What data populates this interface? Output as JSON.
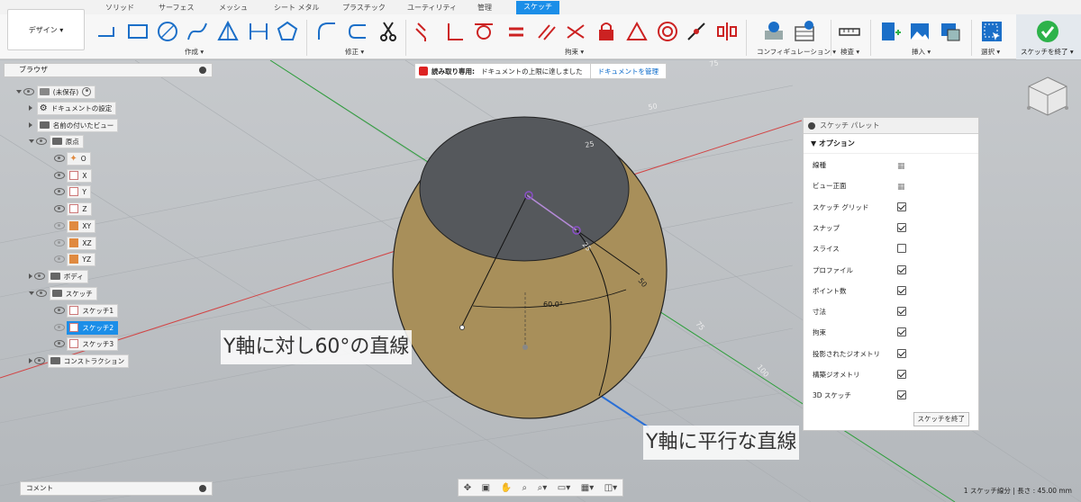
{
  "tabs": [
    "ソリッド",
    "サーフェス",
    "メッシュ",
    "シート メタル",
    "プラスチック",
    "ユーティリティ",
    "管理",
    "スケッチ"
  ],
  "design_button": "デザイン ▾",
  "ribbon_groups": {
    "create": "作成 ▾",
    "modify": "修正 ▾",
    "constraints": "拘束 ▾",
    "configuration": "コンフィギュレーション ▾",
    "inspect": "検査 ▾",
    "insert": "挿入 ▾",
    "select": "選択 ▾",
    "finish": "スケッチを終了 ▾"
  },
  "browser": {
    "title": "ブラウザ",
    "items": [
      {
        "label": "(未保存)"
      },
      {
        "label": "ドキュメントの設定"
      },
      {
        "label": "名前の付いたビュー"
      },
      {
        "label": "原点"
      },
      {
        "label": "O"
      },
      {
        "label": "X"
      },
      {
        "label": "Y"
      },
      {
        "label": "Z"
      },
      {
        "label": "XY"
      },
      {
        "label": "XZ"
      },
      {
        "label": "YZ"
      },
      {
        "label": "ボディ"
      },
      {
        "label": "スケッチ"
      },
      {
        "label": "スケッチ1"
      },
      {
        "label": "スケッチ2"
      },
      {
        "label": "スケッチ3"
      },
      {
        "label": "コンストラクション"
      }
    ]
  },
  "banner": {
    "prefix": "読み取り専用:",
    "message": "ドキュメントの上限に達しました",
    "action": "ドキュメントを管理"
  },
  "palette": {
    "title": "スケッチ パレット",
    "section": "▼ オプション",
    "rows": [
      {
        "label": "線種",
        "checked": null
      },
      {
        "label": "ビュー正面",
        "checked": null
      },
      {
        "label": "スケッチ グリッド",
        "checked": true
      },
      {
        "label": "スナップ",
        "checked": true
      },
      {
        "label": "スライス",
        "checked": false
      },
      {
        "label": "プロファイル",
        "checked": true
      },
      {
        "label": "ポイント数",
        "checked": true
      },
      {
        "label": "寸法",
        "checked": true
      },
      {
        "label": "拘束",
        "checked": true
      },
      {
        "label": "投影されたジオメトリ",
        "checked": true
      },
      {
        "label": "構築ジオメトリ",
        "checked": true
      },
      {
        "label": "3D スケッチ",
        "checked": true
      }
    ],
    "finish_button": "スケッチを終了"
  },
  "viewport": {
    "angle_label": "60.0°",
    "axis_ticks": [
      "75",
      "50",
      "25",
      "25",
      "50",
      "75",
      "100"
    ]
  },
  "callouts": {
    "line60": "Y軸に対し60°の直線",
    "parallel": "Y軸に平行な直線"
  },
  "comment": "コメント",
  "status": "1 スケッチ線分 | 長さ : 45.00 mm",
  "colors": {
    "accent": "#1b8ee8",
    "sphere": "#a88f5a",
    "finish_check": "#2db24a"
  }
}
